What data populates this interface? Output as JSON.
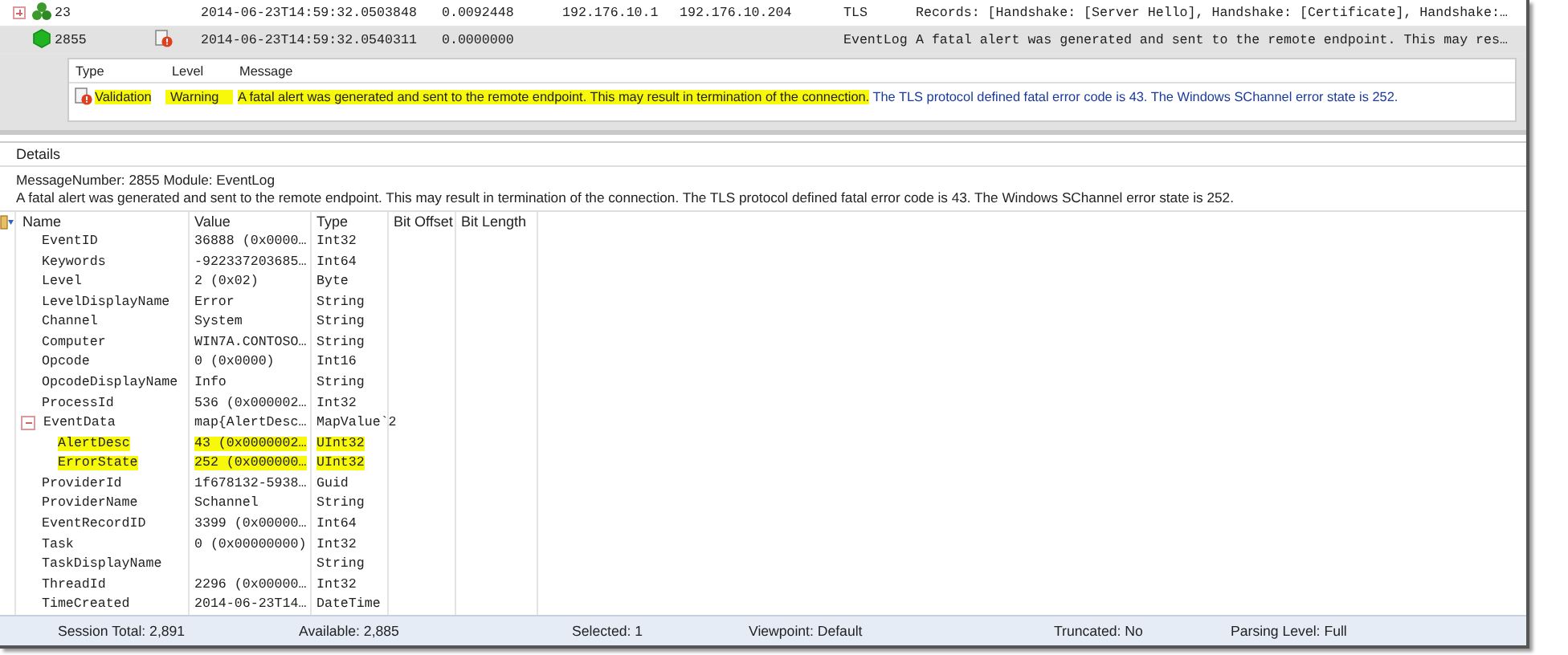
{
  "messages": [
    {
      "expanded": false,
      "kind": "conversation",
      "number": "23",
      "time": "2014-06-23T14:59:32.0503848",
      "elapsed": "0.0092448",
      "source": "192.176.10.1",
      "destination": "192.176.10.204",
      "module": "TLS",
      "summary": "Records: [Handshake: [Server Hello], Handshake: [Certificate], Handshake:…",
      "selected": false,
      "warning": false
    },
    {
      "kind": "message",
      "number": "2855",
      "time": "2014-06-23T14:59:32.0540311",
      "elapsed": "0.0000000",
      "module": "EventLog",
      "summary": "A fatal alert was generated and sent to the remote endpoint. This may res…",
      "selected": true,
      "warning": true
    }
  ],
  "diagnosis": {
    "columns": [
      "Type",
      "Level",
      "Message"
    ],
    "rows": [
      {
        "type": "Validation",
        "level": "Warning",
        "message_highlighted": "A fatal alert was generated and sent to the remote endpoint. This may result in termination of the connection.",
        "message_rest": "The TLS protocol defined fatal error code is 43. The Windows SChannel error state is 252.",
        "highlighted": true
      }
    ]
  },
  "details": {
    "title": "Details",
    "header_line": "MessageNumber: 2855 Module: EventLog",
    "text": "A fatal alert was generated and sent to the remote endpoint. This may result in termination of the connection. The TLS protocol defined fatal error code is 43. The Windows SChannel error state is 252."
  },
  "properties": {
    "columns": [
      "Name",
      "Value",
      "Type",
      "Bit Offset",
      "Bit Length"
    ],
    "rows": [
      {
        "name": "EventID",
        "value": "36888 (0x0000…",
        "type": "Int32"
      },
      {
        "name": "Keywords",
        "value": "-922337203685…",
        "type": "Int64"
      },
      {
        "name": "Level",
        "value": "2 (0x02)",
        "type": "Byte"
      },
      {
        "name": "LevelDisplayName",
        "value": "Error",
        "type": "String"
      },
      {
        "name": "Channel",
        "value": "System",
        "type": "String"
      },
      {
        "name": "Computer",
        "value": "WIN7A.CONTOSO…",
        "type": "String"
      },
      {
        "name": "Opcode",
        "value": "0 (0x0000)",
        "type": "Int16"
      },
      {
        "name": "OpcodeDisplayName",
        "value": "Info",
        "type": "String"
      },
      {
        "name": "ProcessId",
        "value": "536 (0x000002…",
        "type": "Int32"
      },
      {
        "name": "EventData",
        "value": "map{AlertDesc…",
        "type": "MapValue`2",
        "expanded": true,
        "children": [
          {
            "name": "AlertDesc",
            "value": "43 (0x0000002…",
            "type": "UInt32",
            "highlighted": true
          },
          {
            "name": "ErrorState",
            "value": "252 (0x000000…",
            "type": "UInt32",
            "highlighted": true
          }
        ]
      },
      {
        "name": "ProviderId",
        "value": "1f678132-5938…",
        "type": "Guid"
      },
      {
        "name": "ProviderName",
        "value": "Schannel",
        "type": "String"
      },
      {
        "name": "EventRecordID",
        "value": "3399 (0x00000…",
        "type": "Int64"
      },
      {
        "name": "Task",
        "value": "0 (0x00000000)",
        "type": "Int32"
      },
      {
        "name": "TaskDisplayName",
        "type": "String"
      },
      {
        "name": "ThreadId",
        "value": "2296 (0x00000…",
        "type": "Int32"
      },
      {
        "name": "TimeCreated",
        "value": "2014-06-23T14…",
        "type": "DateTime"
      }
    ]
  },
  "status_bar": [
    "Session Total: 2,891",
    "Available: 2,885",
    "Selected: 1",
    "Viewpoint: Default",
    "Truncated: No",
    "Parsing Level: Full"
  ]
}
